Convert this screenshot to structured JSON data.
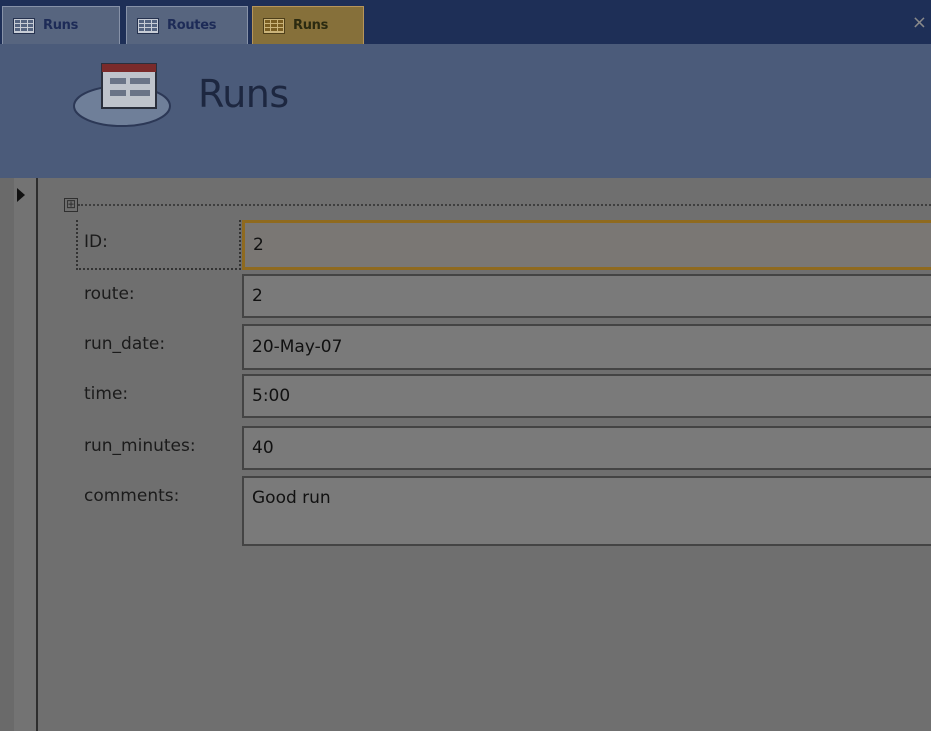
{
  "tabs": [
    {
      "label": "Runs",
      "icon": "table-icon",
      "active": false
    },
    {
      "label": "Routes",
      "icon": "table-icon",
      "active": false
    },
    {
      "label": "Runs",
      "icon": "form-icon",
      "active": true
    }
  ],
  "close_glyph": "×",
  "header": {
    "title": "Runs",
    "logo_icon": "form-logo-icon"
  },
  "layout_selector_glyph": "⊞",
  "fields": [
    {
      "label": "ID:",
      "value": "2"
    },
    {
      "label": "route:",
      "value": "2"
    },
    {
      "label": "run_date:",
      "value": "20-May-07"
    },
    {
      "label": "time:",
      "value": "5:00"
    },
    {
      "label": "run_minutes:",
      "value": "40"
    },
    {
      "label": "comments:",
      "value": "Good run"
    }
  ],
  "colors": {
    "tab_strip": "#1e2f57",
    "header": "#4b5b7a",
    "detail": "#6f6f6f",
    "focus_border": "#8f6a1f"
  }
}
